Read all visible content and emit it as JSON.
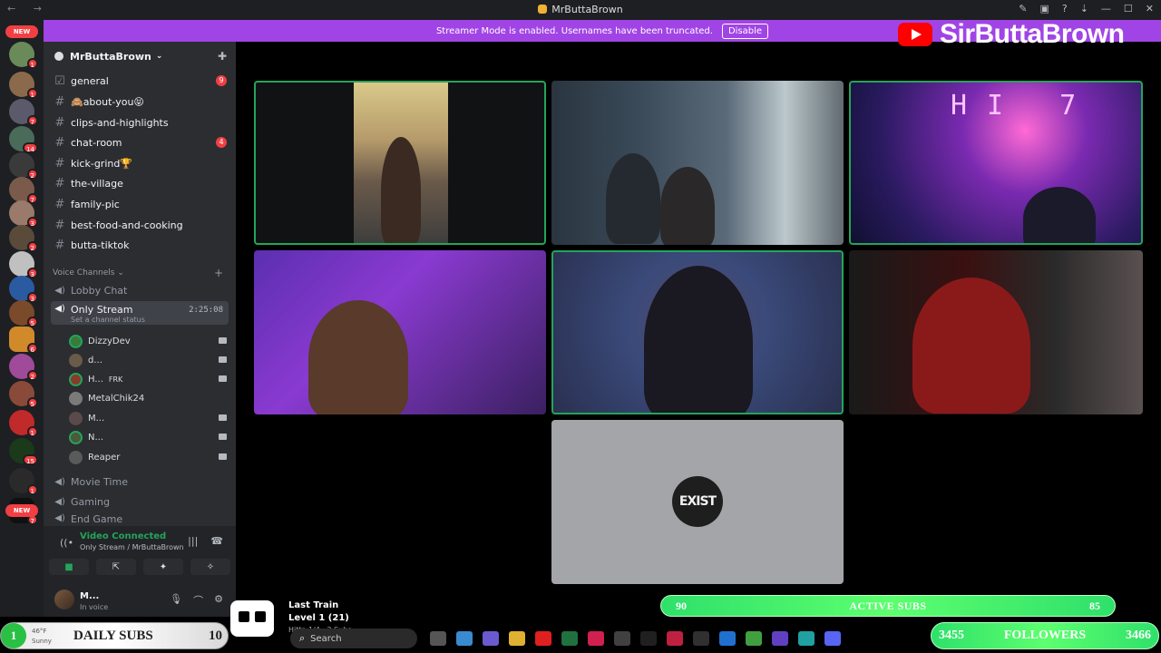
{
  "titlebar": {
    "title": "MrButtaBrown",
    "nav": "← →"
  },
  "banner": {
    "message": "Streamer Mode is enabled. Usernames have been truncated.",
    "disable_label": "Disable"
  },
  "youtube_overlay": {
    "name": "SirButtaBrown"
  },
  "rail": {
    "new_top": "NEW",
    "new_bottom": "NEW",
    "badges": [
      "1",
      "1",
      "7",
      "14",
      "2",
      "7",
      "3",
      "2",
      "3",
      "3",
      "5",
      "6",
      "2",
      "5",
      "1",
      "15",
      "1",
      "7"
    ]
  },
  "server": {
    "name": "MrButtaBrown"
  },
  "text_channels": [
    {
      "name": "general",
      "badge": "9"
    },
    {
      "name": "🙈about-you😝",
      "badge": ""
    },
    {
      "name": "clips-and-highlights",
      "badge": ""
    },
    {
      "name": "chat-room",
      "badge": "4"
    },
    {
      "name": "kick-grind🏆",
      "badge": ""
    },
    {
      "name": "the-village",
      "badge": ""
    },
    {
      "name": "family-pic",
      "badge": ""
    },
    {
      "name": "best-food-and-cooking",
      "badge": ""
    },
    {
      "name": "butta-tiktok",
      "badge": ""
    }
  ],
  "voice": {
    "header": "Voice Channels",
    "lobby": "Lobby Chat",
    "active_channel": "Only Stream",
    "timer": "2:25:08",
    "status_prompt": "Set a channel status",
    "members": [
      {
        "name": "DizzyDev",
        "tag": ""
      },
      {
        "name": "d...",
        "tag": ""
      },
      {
        "name": "H...",
        "tag": "FRK"
      },
      {
        "name": "MetalChik24",
        "tag": ""
      },
      {
        "name": "M...",
        "tag": ""
      },
      {
        "name": "N...",
        "tag": ""
      },
      {
        "name": "Reaper",
        "tag": ""
      }
    ],
    "other_channels": [
      "Movie Time",
      "Gaming",
      "End Game"
    ]
  },
  "voice_panel": {
    "title": "Video Connected",
    "subtitle": "Only Stream / MrButtaBrown"
  },
  "user": {
    "name": "M...",
    "status": "In voice"
  },
  "tiles": {
    "offline_label": "EXIST",
    "hi_text": "HI 7"
  },
  "overlays": {
    "active_subs": {
      "left": "90",
      "label": "ACTIVE SUBS",
      "right": "85"
    },
    "last_train": {
      "title": "Last Train",
      "level": "Level 1  (21)",
      "subs": "Hitta 1/4 · 2 Subs"
    },
    "daily_subs": {
      "count": "1",
      "label": "DAILY SUBS",
      "value": "10",
      "temp": "46°F",
      "weather": "Sunny"
    },
    "followers": {
      "left": "3455",
      "label": "FOLLOWERS",
      "right": "3466"
    }
  },
  "taskbar": {
    "search_placeholder": "Search"
  },
  "colors": {
    "discord_green": "#23a55a",
    "banner_purple": "#a144e5",
    "overlay_green": "#2fe06a",
    "badge_red": "#f23f43"
  }
}
